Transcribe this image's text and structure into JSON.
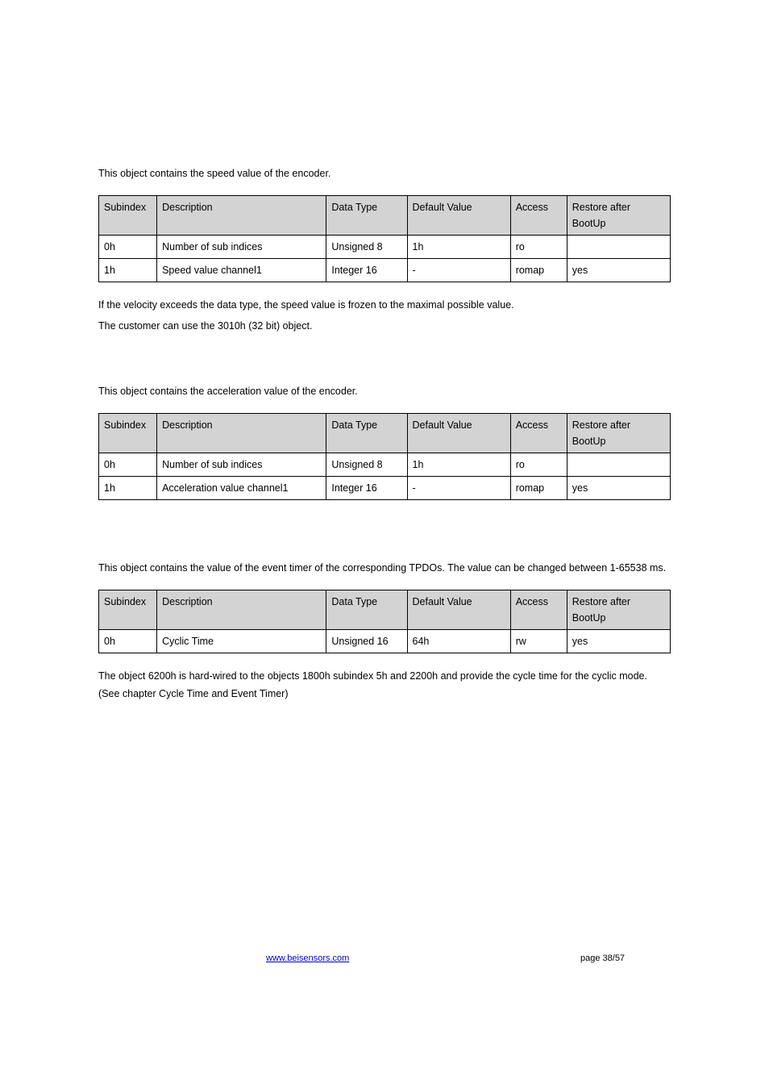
{
  "sec1": {
    "intro": "This object contains the speed value of the encoder.",
    "note1": "If the velocity exceeds the data type, the speed value is frozen to the maximal possible value.",
    "note2": "The customer can use the 3010h (32 bit) object.",
    "headers": {
      "sub": "Subindex",
      "desc": "Description",
      "dt": "Data Type",
      "dv": "Default Value",
      "acc": "Access",
      "rest": "Restore after BootUp"
    },
    "rows": [
      {
        "sub": "0h",
        "desc": "Number of sub indices",
        "dt": "Unsigned 8",
        "dv": "1h",
        "acc": "ro",
        "rest": ""
      },
      {
        "sub": "1h",
        "desc": "Speed value channel1",
        "dt": "Integer 16",
        "dv": "-",
        "acc": "romap",
        "rest": "yes"
      }
    ]
  },
  "sec2": {
    "intro": "This object contains the acceleration value of the encoder.",
    "headers": {
      "sub": "Subindex",
      "desc": "Description",
      "dt": "Data Type",
      "dv": "Default Value",
      "acc": "Access",
      "rest": "Restore after BootUp"
    },
    "rows": [
      {
        "sub": "0h",
        "desc": "Number of sub indices",
        "dt": "Unsigned 8",
        "dv": "1h",
        "acc": "ro",
        "rest": ""
      },
      {
        "sub": "1h",
        "desc": "Acceleration value channel1",
        "dt": "Integer 16",
        "dv": "-",
        "acc": "romap",
        "rest": "yes"
      }
    ]
  },
  "sec3": {
    "intro": "This object contains the value of the event timer of the corresponding TPDOs. The value can be changed between 1-65538 ms.",
    "headers": {
      "sub": "Subindex",
      "desc": "Description",
      "dt": "Data Type",
      "dv": "Default Value",
      "acc": "Access",
      "rest": "Restore after BootUp"
    },
    "rows": [
      {
        "sub": "0h",
        "desc": "Cyclic Time",
        "dt": "Unsigned 16",
        "dv": "64h",
        "acc": "rw",
        "rest": "yes"
      }
    ],
    "note": "The object 6200h is hard-wired to the objects 1800h subindex 5h and 2200h and provide the cycle time for the cyclic mode. (See chapter Cycle Time and Event Timer)"
  },
  "footer": {
    "link": "www.beisensors.com",
    "page": "page 38/57"
  }
}
